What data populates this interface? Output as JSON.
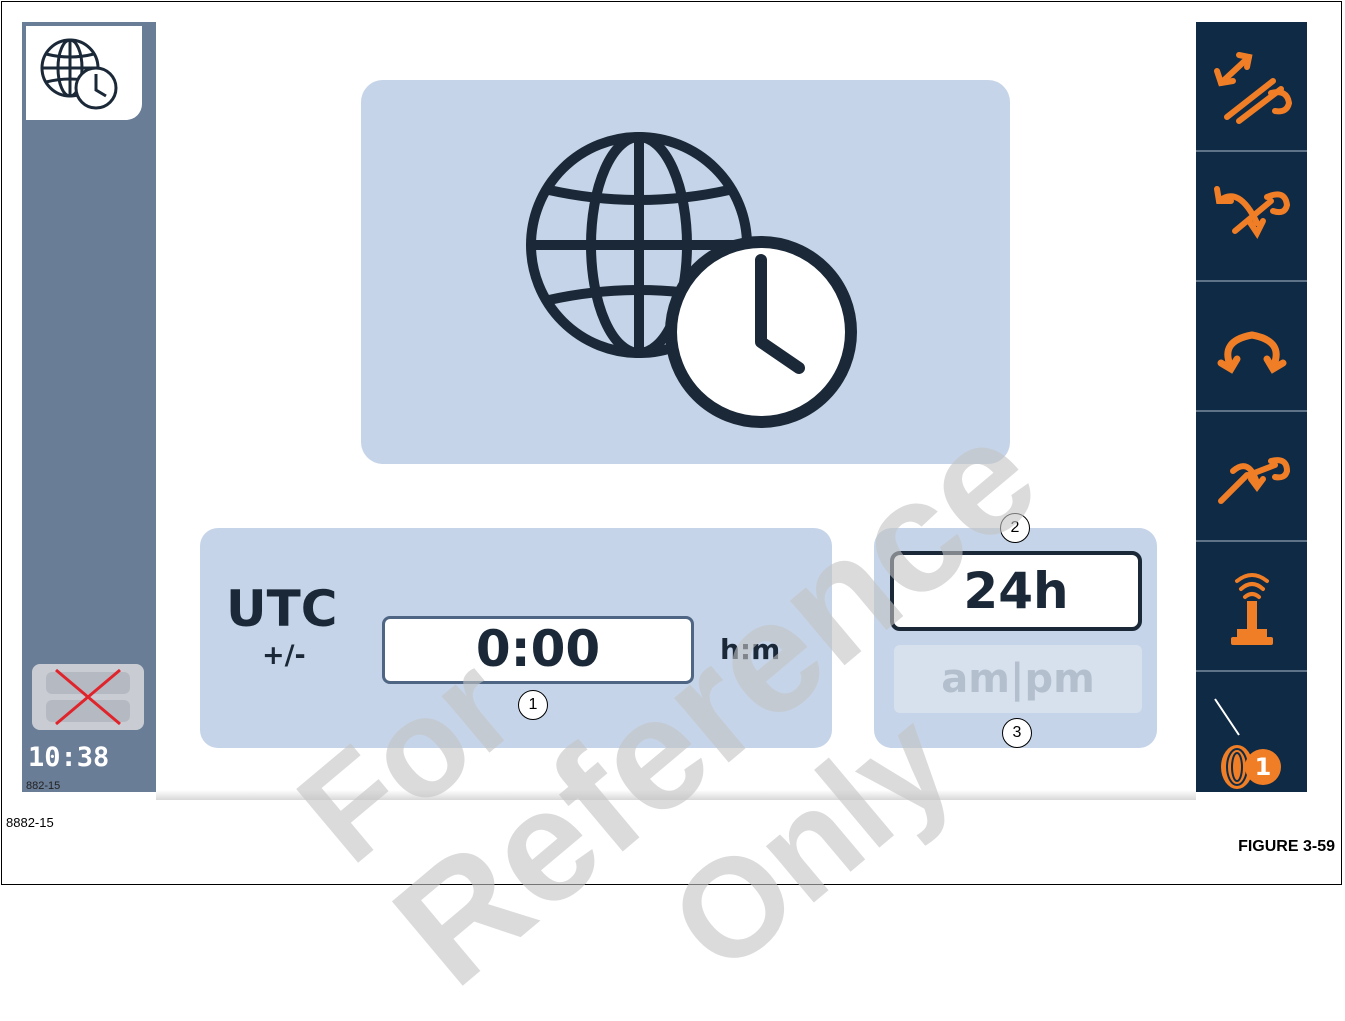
{
  "sidebar": {
    "screen_icon": "globe-clock-icon",
    "clock": "10:38",
    "code": "882-15",
    "status_icon": "disconnected-x-icon"
  },
  "hero": {
    "icon": "globe-clock-icon"
  },
  "utc": {
    "label": "UTC",
    "sign": "+/-",
    "offset_value": "0:00",
    "unit": "h:m"
  },
  "time_format": {
    "selected": "24h",
    "alternate": "am|pm"
  },
  "callouts": [
    "1",
    "2",
    "3"
  ],
  "right_toolbar": {
    "items": [
      {
        "icon": "telescope-extend-retract-icon"
      },
      {
        "icon": "boom-lift-lower-icon"
      },
      {
        "icon": "swing-icon"
      },
      {
        "icon": "jib-icon"
      },
      {
        "icon": "remote-control-joystick-icon"
      },
      {
        "icon": "hoist-1-icon",
        "badge": "1"
      }
    ]
  },
  "figure": {
    "code": "8882-15",
    "title": "FIGURE 3-59"
  },
  "watermark": [
    "For",
    "Reference",
    "Only"
  ],
  "colors": {
    "sidebar": "#6a7d96",
    "panel": "#c5d4e8",
    "toolbar": "#0e2a45",
    "accent_orange": "#f07e26",
    "text_dark": "#1a2838"
  }
}
